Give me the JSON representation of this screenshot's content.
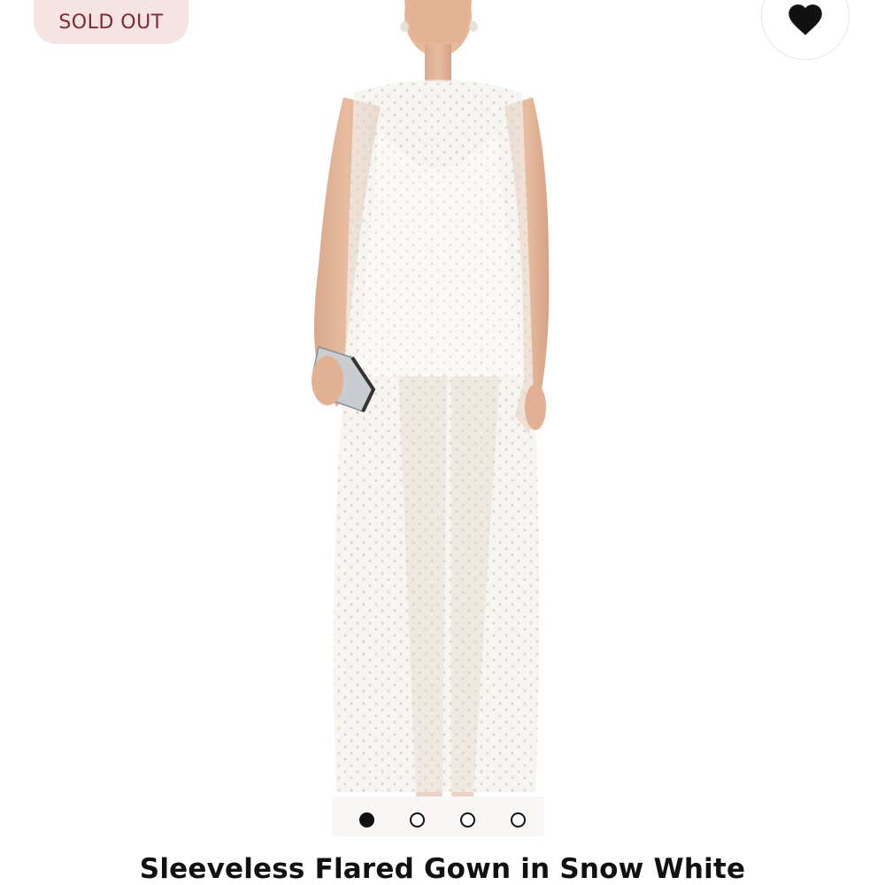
{
  "badge": {
    "label": "SOLD OUT",
    "background_color": "#f6e4e4",
    "text_color": "#7c2a2f"
  },
  "favorite": {
    "icon": "heart-icon",
    "state": "filled"
  },
  "product": {
    "title": "Sleeveless Flared Gown in Snow White",
    "image_alt": "model-wearing-white-sheer-pearl-gown"
  },
  "carousel": {
    "total_images": 4,
    "active_index": 0
  }
}
